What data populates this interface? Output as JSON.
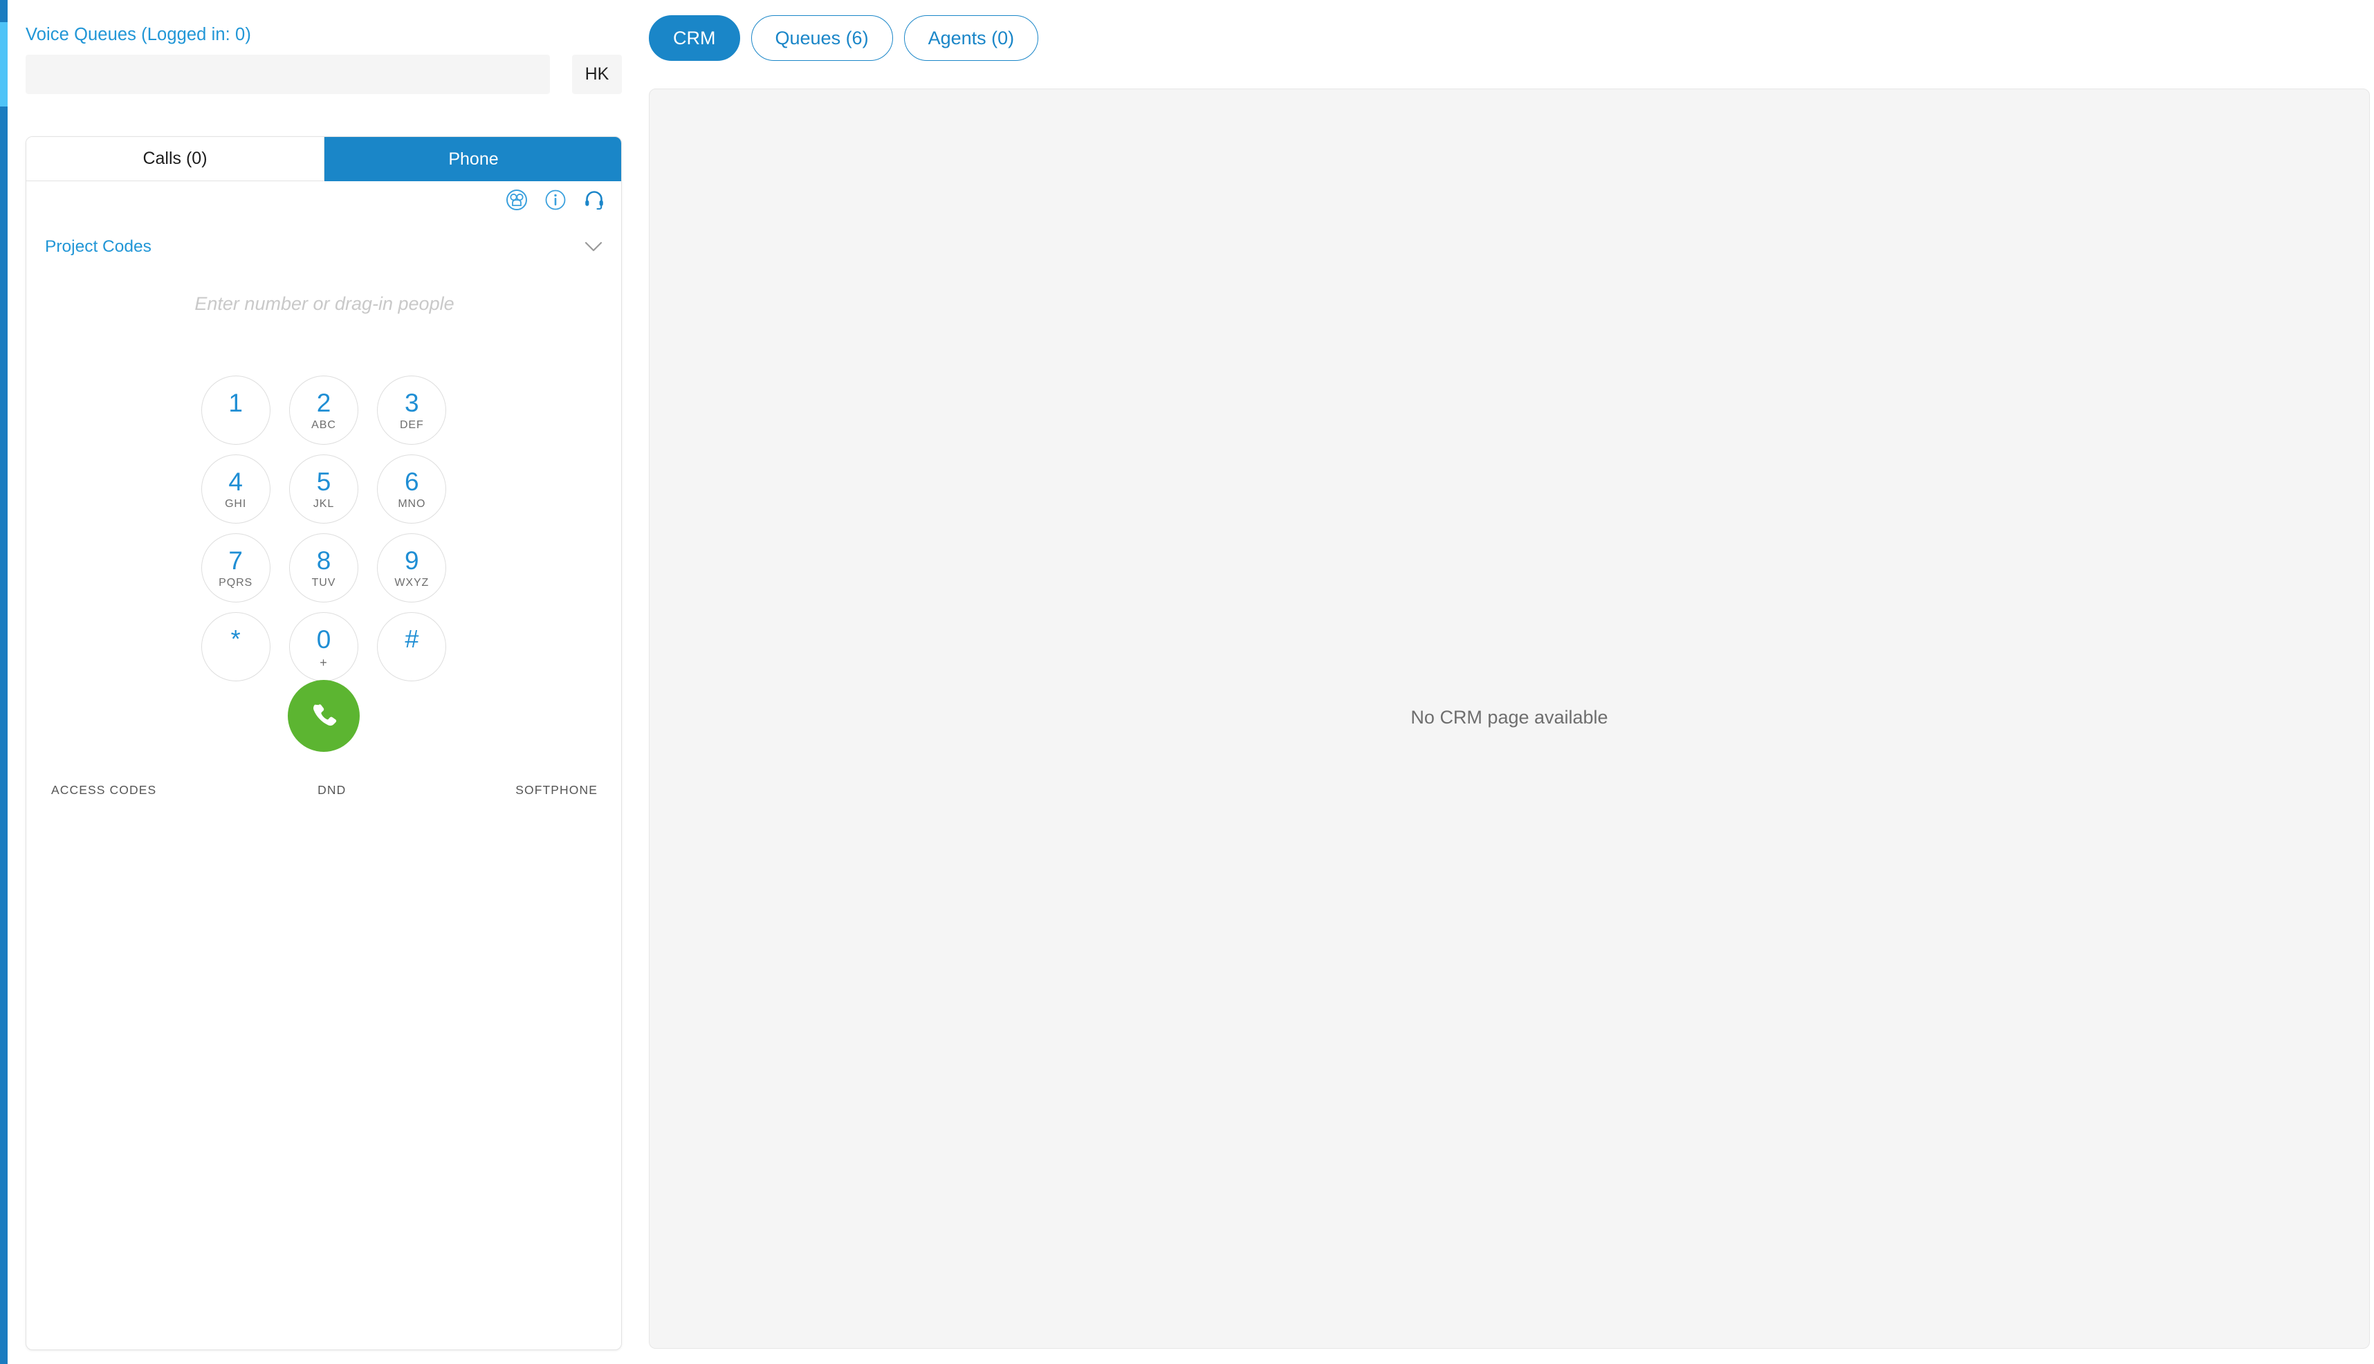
{
  "theme": {
    "accent_blue": "#1a86c8",
    "link_blue": "#2196d6",
    "call_green": "#5cb531",
    "panel_gray": "#f5f5f5",
    "scrollbar_track": "#1a7cc0",
    "scrollbar_thumb": "#4ec3f7"
  },
  "left_panel": {
    "title": "Voice Queues (Logged in: 0)",
    "search": {
      "value": "",
      "placeholder": ""
    },
    "hk_button_label": "HK",
    "tabs": [
      {
        "label": "Calls (0)",
        "active": false
      },
      {
        "label": "Phone",
        "active": true
      }
    ],
    "icons": [
      {
        "name": "contacts-icon",
        "title": "Contacts"
      },
      {
        "name": "info-icon",
        "title": "Info"
      },
      {
        "name": "headset-icon",
        "title": "Headset"
      }
    ],
    "project_codes": {
      "label": "Project Codes",
      "chevron": "chevron-down-icon"
    },
    "number_entry": {
      "value": "",
      "placeholder": "Enter number or drag-in people"
    },
    "dialpad": [
      {
        "digit": "1",
        "letters": ""
      },
      {
        "digit": "2",
        "letters": "ABC"
      },
      {
        "digit": "3",
        "letters": "DEF"
      },
      {
        "digit": "4",
        "letters": "GHI"
      },
      {
        "digit": "5",
        "letters": "JKL"
      },
      {
        "digit": "6",
        "letters": "MNO"
      },
      {
        "digit": "7",
        "letters": "PQRS"
      },
      {
        "digit": "8",
        "letters": "TUV"
      },
      {
        "digit": "9",
        "letters": "WXYZ"
      },
      {
        "digit": "*",
        "letters": ""
      },
      {
        "digit": "0",
        "letters": "+"
      },
      {
        "digit": "#",
        "letters": ""
      }
    ],
    "call_button": {
      "icon": "phone-handset-icon",
      "title": "Call"
    },
    "actions": [
      {
        "label": "ACCESS CODES"
      },
      {
        "label": "DND"
      },
      {
        "label": "SOFTPHONE"
      }
    ]
  },
  "right_panel": {
    "tabs": [
      {
        "label": "CRM",
        "active": true
      },
      {
        "label": "Queues (6)",
        "active": false
      },
      {
        "label": "Agents (0)",
        "active": false
      }
    ],
    "empty_message": "No CRM page available"
  }
}
